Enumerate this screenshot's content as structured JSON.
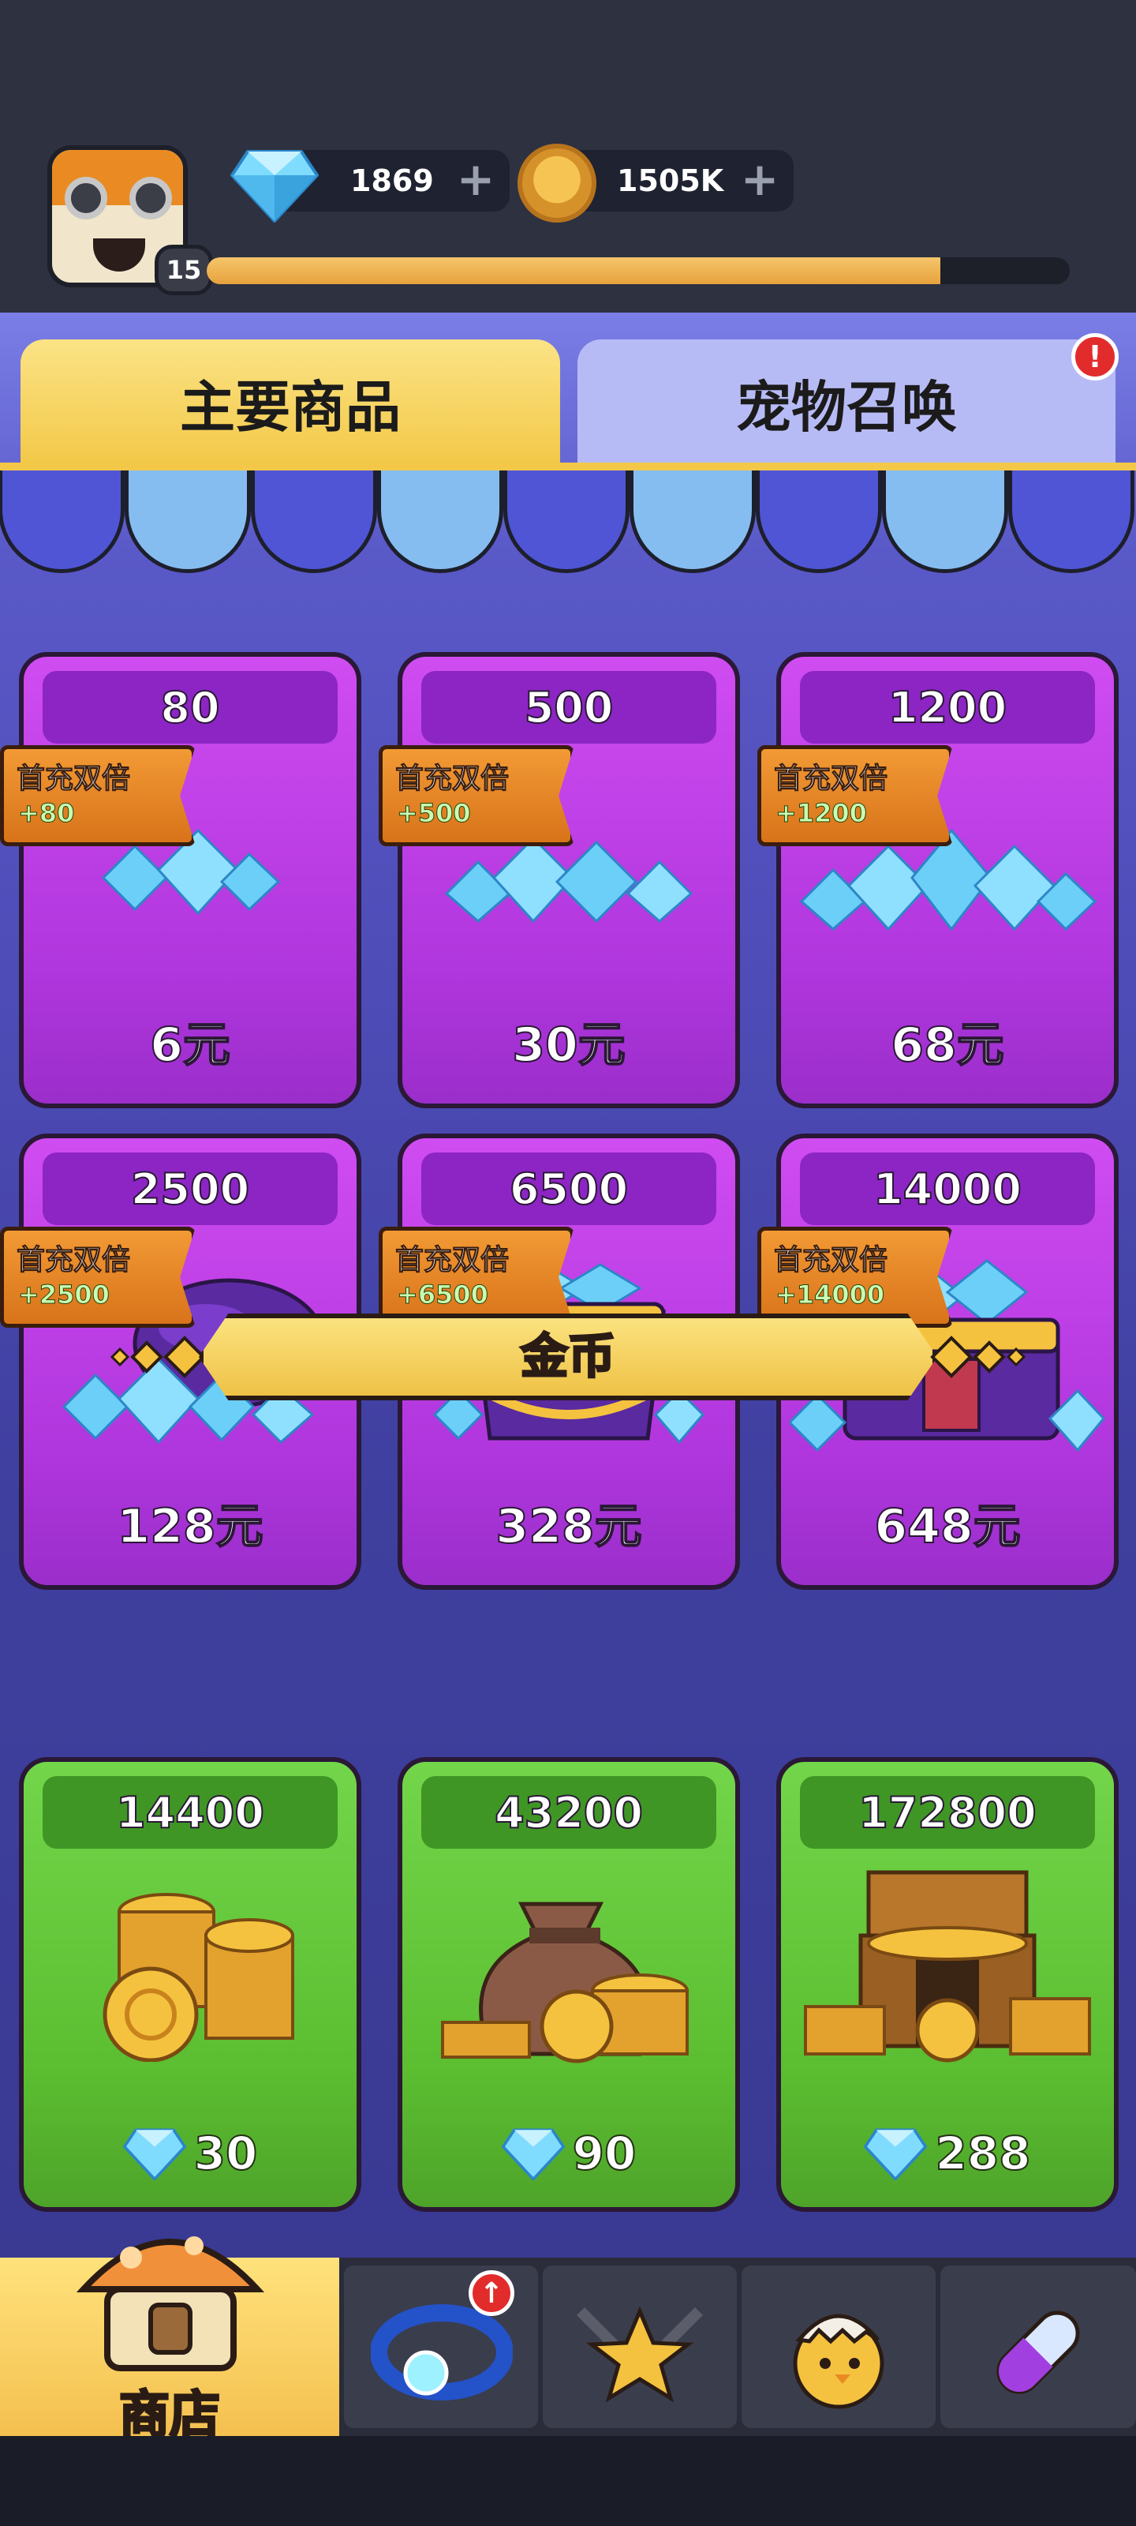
{
  "player": {
    "level": "15",
    "xp_progress": 0.85
  },
  "currencies": {
    "gems": "1869",
    "coins": "1505K"
  },
  "tabs": {
    "main_label": "主要商品",
    "pet_label": "宠物召唤",
    "pet_alert": "!"
  },
  "gem_section": {
    "items": [
      {
        "amount": "80",
        "badge": "首充双倍",
        "bonus": "+80",
        "price": "6元"
      },
      {
        "amount": "500",
        "badge": "首充双倍",
        "bonus": "+500",
        "price": "30元"
      },
      {
        "amount": "1200",
        "badge": "首充双倍",
        "bonus": "+1200",
        "price": "68元"
      },
      {
        "amount": "2500",
        "badge": "首充双倍",
        "bonus": "+2500",
        "price": "128元"
      },
      {
        "amount": "6500",
        "badge": "首充双倍",
        "bonus": "+6500",
        "price": "328元"
      },
      {
        "amount": "14000",
        "badge": "首充双倍",
        "bonus": "+14000",
        "price": "648元"
      }
    ]
  },
  "coin_section": {
    "title": "金币",
    "items": [
      {
        "amount": "14400",
        "cost": "30"
      },
      {
        "amount": "43200",
        "cost": "90"
      },
      {
        "amount": "172800",
        "cost": "288"
      }
    ]
  },
  "nav": {
    "shop_label": "商店",
    "upgrade_badge": "↑"
  },
  "colors": {
    "gem_card": "#c142ea",
    "coin_card": "#62c535",
    "tab_active": "#f3c848",
    "tab_inactive": "#b7bbf5"
  }
}
